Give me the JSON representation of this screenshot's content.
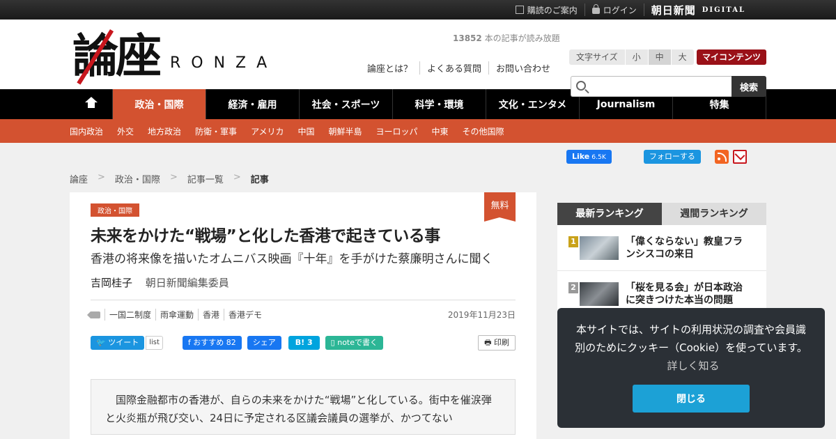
{
  "topbar": {
    "subscribe": "購読のご案内",
    "login": "ログイン",
    "brand": "朝日新聞",
    "brand_sub": "DIGITAL"
  },
  "header": {
    "logo_kanji": "論座",
    "logo_latin": "RONZA",
    "counter_num": "13852",
    "counter_text": "本の記事が読み放題",
    "fontsize_label": "文字サイズ",
    "fontsize_small": "小",
    "fontsize_medium": "中",
    "fontsize_large": "大",
    "mycontent": "マイコンテンツ",
    "links": [
      "論座とは？",
      "よくある質問",
      "お問い合わせ"
    ],
    "search_placeholder": "",
    "search_button": "検索"
  },
  "nav": {
    "items": [
      "政治・国際",
      "経済・雇用",
      "社会・スポーツ",
      "科学・環境",
      "文化・エンタメ",
      "Journalism",
      "特集"
    ]
  },
  "subnav": {
    "items": [
      "国内政治",
      "外交",
      "地方政治",
      "防衛・軍事",
      "アメリカ",
      "中国",
      "朝鮮半島",
      "ヨーロッパ",
      "中東",
      "その他国際"
    ]
  },
  "social": {
    "fb_like": "Like",
    "fb_count": "6.5K",
    "tw_follow": "フォローする"
  },
  "breadcrumb": {
    "items": [
      "論座",
      "政治・国際",
      "記事一覧",
      "記事"
    ],
    "sep": ">"
  },
  "article": {
    "free_badge": "無料",
    "category": "政治・国際",
    "title": "未来をかけた“戦場”と化した香港で起きている事",
    "subtitle": "香港の将来像を描いたオムニバス映画『十年』を手がけた蔡廉明さんに聞く",
    "author": "吉岡桂子",
    "author_org": "朝日新聞編集委員",
    "tags": [
      "一国二制度",
      "雨傘運動",
      "香港",
      "香港デモ"
    ],
    "date": "2019年11月23日",
    "share": {
      "tweet": "ツイート",
      "list": "list",
      "fb_recommend": "おすすめ",
      "fb_count": "82",
      "fb_share": "シェア",
      "hatena": "B!",
      "hatena_count": "3",
      "note": "noteで書く",
      "print": "印刷"
    },
    "lead": "国際金融都市の香港が、自らの未来をかけた“戦場”と化している。街中を催涙弾と火炎瓶が飛び交い、24日に予定される区議会議員の選挙が、かつてない"
  },
  "ranking": {
    "tab_latest": "最新ランキング",
    "tab_weekly": "週間ランキング",
    "items": [
      {
        "num": "1",
        "title": "「偉くならない」教皇フランシスコの来日"
      },
      {
        "num": "2",
        "title": "「桜を見る会」が日本政治に突きつけた本当の問題"
      }
    ]
  },
  "cookie": {
    "text": "本サイトでは、サイトの利用状況の調査や会員識別のためにクッキー（Cookie）を使っています。",
    "more": "詳しく知る",
    "close": "閉じる"
  },
  "colors": {
    "accent": "#d35230",
    "brand_red": "#9a1118"
  }
}
